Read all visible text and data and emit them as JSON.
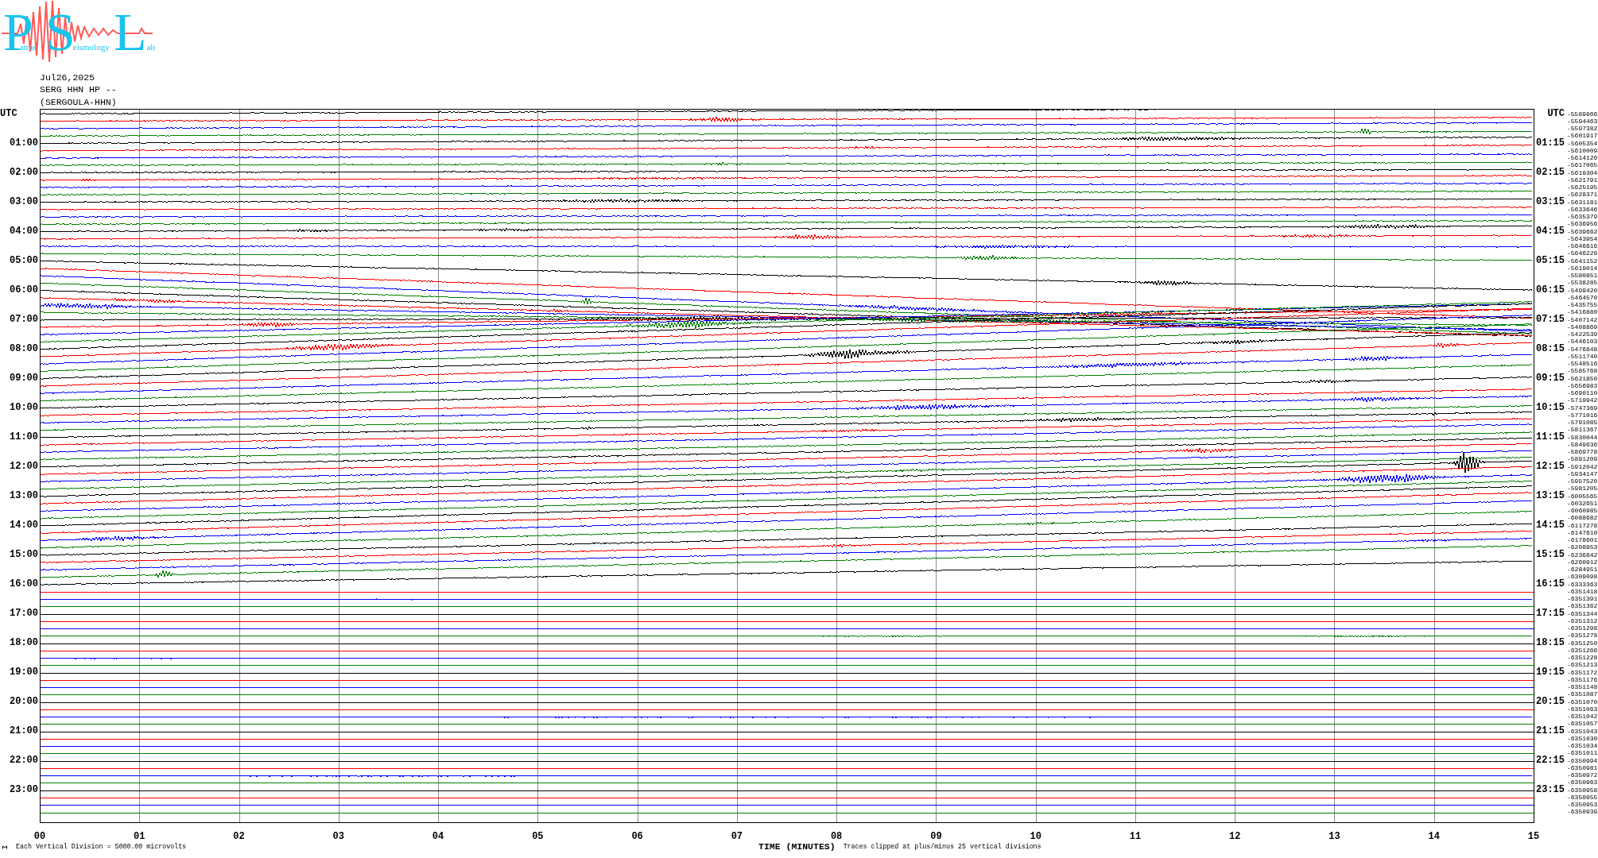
{
  "logo": {
    "parts": [
      {
        "initial": "P",
        "rest": "atras"
      },
      {
        "initial": "S",
        "rest": "eismology"
      },
      {
        "initial": "L",
        "rest": "ab"
      }
    ]
  },
  "header": {
    "date": "Jul26,2025",
    "channel": "SERG HHN HP --",
    "station": "(SERGOULA-HHN)"
  },
  "helicorder": {
    "left_title": "UTC",
    "right_title": "UTC",
    "rows": [
      {
        "value": "-5589866"
      },
      {
        "value": "-5594463"
      },
      {
        "value": "-5597382"
      },
      {
        "value": "-5601917"
      },
      {
        "value": "-5605354",
        "start": "01:00",
        "end": "01:15"
      },
      {
        "value": "-5610009"
      },
      {
        "value": "-5614126"
      },
      {
        "value": "-5617065"
      },
      {
        "value": "-5619304",
        "start": "02:00",
        "end": "02:15"
      },
      {
        "value": "-5621791"
      },
      {
        "value": "-5625195"
      },
      {
        "value": "-5628371"
      },
      {
        "value": "-5631181",
        "start": "03:00",
        "end": "03:15"
      },
      {
        "value": "-5633646"
      },
      {
        "value": "-5635379"
      },
      {
        "value": "-5636956"
      },
      {
        "value": "-5639662",
        "start": "04:00",
        "end": "04:15"
      },
      {
        "value": "-5643954"
      },
      {
        "value": "-5646616"
      },
      {
        "value": "-5646229"
      },
      {
        "value": "-5641152",
        "start": "05:00",
        "end": "05:15"
      },
      {
        "value": "-5619014"
      },
      {
        "value": "-5580851"
      },
      {
        "value": "-5538285"
      },
      {
        "value": "-5499420",
        "start": "06:00",
        "end": "06:15"
      },
      {
        "value": "-5464570"
      },
      {
        "value": "-5435755"
      },
      {
        "value": "-5416880"
      },
      {
        "value": "-5407142",
        "start": "07:00",
        "end": "07:15"
      },
      {
        "value": "-5408869"
      },
      {
        "value": "-5422539"
      },
      {
        "value": "-5446103"
      },
      {
        "value": "-5476848",
        "start": "08:00",
        "end": "08:15"
      },
      {
        "value": "-5511740"
      },
      {
        "value": "-5548516"
      },
      {
        "value": "-5585768"
      },
      {
        "value": "-5621850",
        "start": "09:00",
        "end": "09:15"
      },
      {
        "value": "-5656983"
      },
      {
        "value": "-5690110"
      },
      {
        "value": "-5719942"
      },
      {
        "value": "-5747369",
        "start": "10:00",
        "end": "10:15"
      },
      {
        "value": "-5771016"
      },
      {
        "value": "-5791085"
      },
      {
        "value": "-5811367"
      },
      {
        "value": "-5830044",
        "start": "11:00",
        "end": "11:15"
      },
      {
        "value": "-5849636"
      },
      {
        "value": "-5869778"
      },
      {
        "value": "-5891209"
      },
      {
        "value": "-5912042",
        "start": "12:00",
        "end": "12:15"
      },
      {
        "value": "-5934147"
      },
      {
        "value": "-5957520"
      },
      {
        "value": "-5981205"
      },
      {
        "value": "-6005565",
        "start": "13:00",
        "end": "13:15"
      },
      {
        "value": "-6032651"
      },
      {
        "value": "-6060985"
      },
      {
        "value": "-6088682"
      },
      {
        "value": "-6117278",
        "start": "14:00",
        "end": "14:15"
      },
      {
        "value": "-6147610"
      },
      {
        "value": "-6178601"
      },
      {
        "value": "-6208953"
      },
      {
        "value": "-6236842",
        "start": "15:00",
        "end": "15:15"
      },
      {
        "value": "-6260912"
      },
      {
        "value": "-6284951"
      },
      {
        "value": "-6309098"
      },
      {
        "value": "-6333363",
        "start": "16:00",
        "end": "16:15"
      },
      {
        "value": "-6351418"
      },
      {
        "value": "-6351391"
      },
      {
        "value": "-6351362"
      },
      {
        "value": "-6351344",
        "start": "17:00",
        "end": "17:15"
      },
      {
        "value": "-6351312"
      },
      {
        "value": "-6351298"
      },
      {
        "value": "-6351278"
      },
      {
        "value": "-6351250",
        "start": "18:00",
        "end": "18:15"
      },
      {
        "value": "-6351266"
      },
      {
        "value": "-6351228"
      },
      {
        "value": "-6351213"
      },
      {
        "value": "-6351172",
        "start": "19:00",
        "end": "19:15"
      },
      {
        "value": "-6351176"
      },
      {
        "value": "-6351148"
      },
      {
        "value": "-6351087"
      },
      {
        "value": "-6351070",
        "start": "20:00",
        "end": "20:15"
      },
      {
        "value": "-6351063"
      },
      {
        "value": "-6351042"
      },
      {
        "value": "-6351057"
      },
      {
        "value": "-6351043",
        "start": "21:00",
        "end": "21:15"
      },
      {
        "value": "-6351030"
      },
      {
        "value": "-6351034"
      },
      {
        "value": "-6351011"
      },
      {
        "value": "-6350994",
        "start": "22:00",
        "end": "22:15"
      },
      {
        "value": "-6350981"
      },
      {
        "value": "-6350972"
      },
      {
        "value": "-6350963"
      },
      {
        "value": "-6350958",
        "start": "23:00",
        "end": "23:15"
      },
      {
        "value": "-6350955"
      },
      {
        "value": "-6350953"
      },
      {
        "value": "-6350939"
      }
    ]
  },
  "x_axis": {
    "ticks": [
      "00",
      "01",
      "02",
      "03",
      "04",
      "05",
      "06",
      "07",
      "08",
      "09",
      "10",
      "11",
      "12",
      "13",
      "14",
      "15"
    ],
    "title": "TIME (MINUTES)"
  },
  "notes": {
    "scale": "Each Vertical Division = 5000.00 microvolts",
    "clipping": "Traces clipped at plus/minus 25 vertical divisions"
  }
}
